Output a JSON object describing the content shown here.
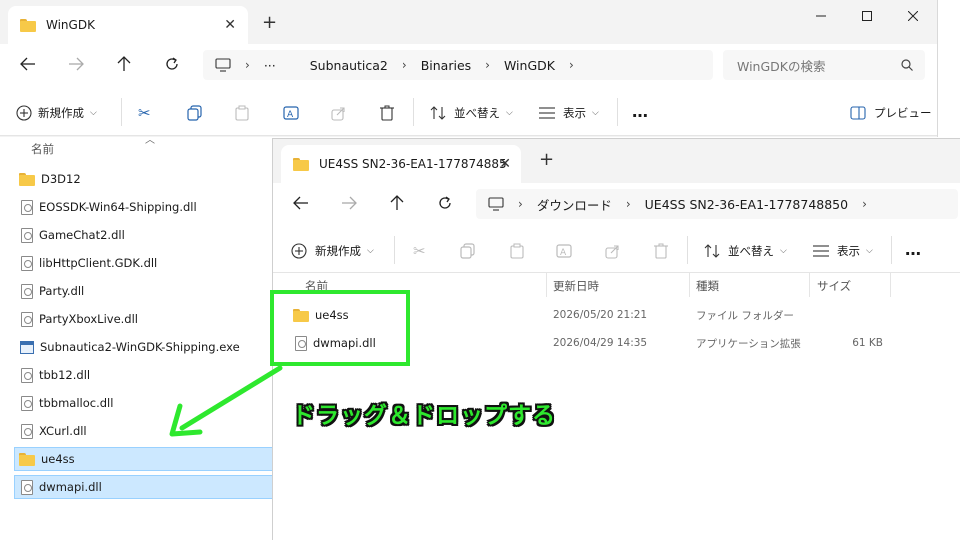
{
  "back_window": {
    "tab": {
      "title": "WinGDK"
    },
    "breadcrumb": [
      "Subnautica2",
      "Binaries",
      "WinGDK"
    ],
    "search_placeholder": "WinGDKの検索",
    "toolbar": {
      "new": "新規作成",
      "sort": "並べ替え",
      "view": "表示",
      "more": "…",
      "preview": "プレビュー"
    },
    "column_name": "名前",
    "files": [
      {
        "name": "D3D12",
        "type": "folder"
      },
      {
        "name": "EOSSDK-Win64-Shipping.dll",
        "type": "file"
      },
      {
        "name": "GameChat2.dll",
        "type": "file"
      },
      {
        "name": "libHttpClient.GDK.dll",
        "type": "file"
      },
      {
        "name": "Party.dll",
        "type": "file"
      },
      {
        "name": "PartyXboxLive.dll",
        "type": "file"
      },
      {
        "name": "Subnautica2-WinGDK-Shipping.exe",
        "type": "exe"
      },
      {
        "name": "tbb12.dll",
        "type": "file"
      },
      {
        "name": "tbbmalloc.dll",
        "type": "file"
      },
      {
        "name": "XCurl.dll",
        "type": "file"
      },
      {
        "name": "ue4ss",
        "type": "folder",
        "selected": true
      },
      {
        "name": "dwmapi.dll",
        "type": "file",
        "selected": true
      }
    ]
  },
  "front_window": {
    "tab": {
      "title": "UE4SS SN2-36-EA1-177874885"
    },
    "breadcrumb": [
      "ダウンロード",
      "UE4SS SN2-36-EA1-1778748850"
    ],
    "toolbar": {
      "new": "新規作成",
      "sort": "並べ替え",
      "view": "表示",
      "more": "…"
    },
    "columns": {
      "name": "名前",
      "date": "更新日時",
      "type": "種類",
      "size": "サイズ"
    },
    "files": [
      {
        "name": "ue4ss",
        "icon": "folder",
        "date": "2026/05/20 21:21",
        "type": "ファイル フォルダー",
        "size": ""
      },
      {
        "name": "dwmapi.dll",
        "icon": "file",
        "date": "2026/04/29 14:35",
        "type": "アプリケーション拡張",
        "size": "61 KB"
      }
    ]
  },
  "annotation": {
    "text": "ドラッグ＆ドロップする",
    "color": "#2ee82e"
  }
}
